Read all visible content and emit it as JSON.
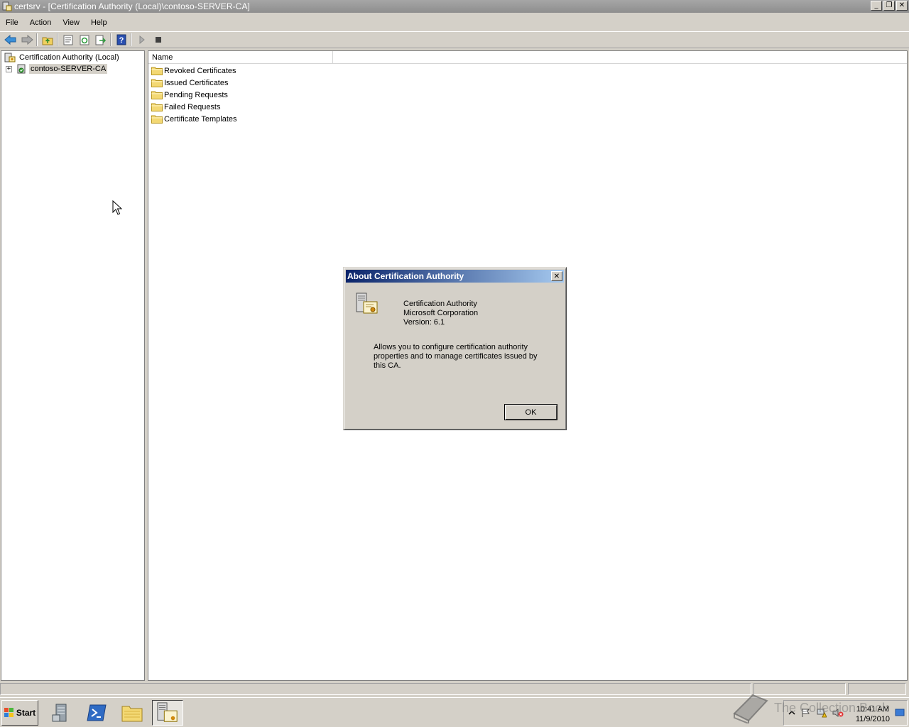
{
  "window": {
    "title": "certsrv - [Certification Authority (Local)\\contoso-SERVER-CA]",
    "controls": {
      "minimize": "_",
      "restore": "❐",
      "close": "✕"
    }
  },
  "menu": {
    "file": "File",
    "action": "Action",
    "view": "View",
    "help": "Help"
  },
  "toolbar": {
    "buttons": [
      "back-icon",
      "forward-icon",
      "up-folder-icon",
      "properties-icon",
      "refresh-icon",
      "export-list-icon",
      "help-icon",
      "start-service-icon",
      "stop-service-icon"
    ]
  },
  "tree": {
    "root_label": "Certification Authority (Local)",
    "child_label": "contoso-SERVER-CA",
    "expander": "+"
  },
  "list": {
    "column_name": "Name",
    "items": [
      "Revoked Certificates",
      "Issued Certificates",
      "Pending Requests",
      "Failed Requests",
      "Certificate Templates"
    ]
  },
  "dialog": {
    "title": "About Certification Authority",
    "close_glyph": "✕",
    "product": "Certification Authority",
    "company": "Microsoft Corporation",
    "version": "Version: 6.1",
    "description": "Allows you to configure certification authority properties and to manage certificates issued by this CA.",
    "ok_label": "OK"
  },
  "taskbar": {
    "start_label": "Start",
    "clock_time": "10:41 AM",
    "clock_date": "11/9/2010"
  },
  "watermark": {
    "text": "The Collection Book"
  },
  "colors": {
    "dialog_title_start": "#0a246a",
    "dialog_title_end": "#a6caf0",
    "window_title_bar": "#8e8e8e",
    "face": "#d4d0c8"
  }
}
